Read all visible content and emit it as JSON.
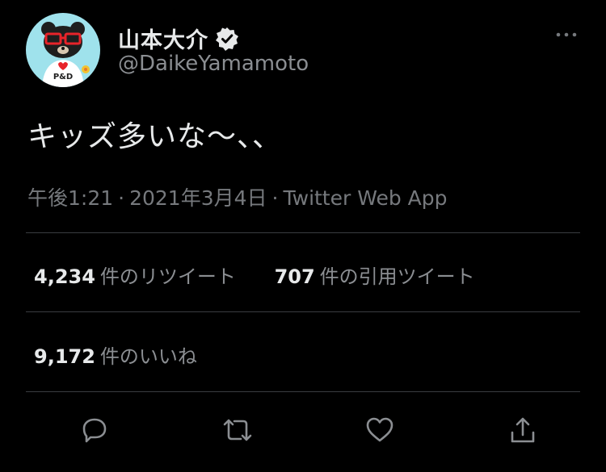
{
  "tweet": {
    "author_name": "山本大介",
    "handle": "@DaikeYamamoto",
    "text": "キッズ多いな〜、、",
    "time": "午後1:21",
    "date": "2021年3月4日",
    "client": "Twitter Web App",
    "separator": "·"
  },
  "stats": {
    "retweets_count": "4,234",
    "retweets_label": "件のリツイート",
    "quotes_count": "707",
    "quotes_label": "件の引用ツイート",
    "likes_count": "9,172",
    "likes_label": "件のいいね"
  },
  "avatar": {
    "shirt_text": "P&D"
  },
  "icons": {
    "more": "more-dots-icon",
    "verified": "verified-badge-icon",
    "reply": "reply-icon",
    "retweet": "retweet-icon",
    "like": "heart-icon",
    "share": "share-icon"
  },
  "colors": {
    "background": "#000000",
    "text_primary": "#e7e9ea",
    "text_secondary": "#8b8e92",
    "avatar_bg": "#9fe2ec",
    "avatar_glasses": "#e8242a"
  }
}
